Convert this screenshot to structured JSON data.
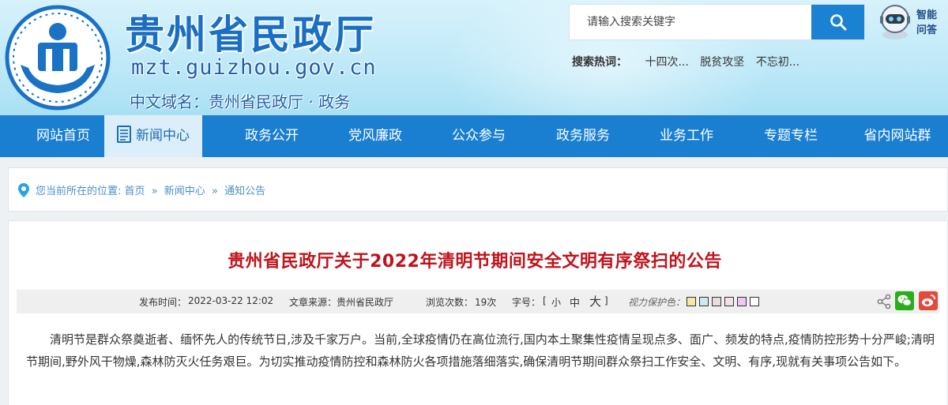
{
  "header": {
    "title": "贵州省民政厅",
    "domain": "mzt.guizhou.gov.cn",
    "cn_domain": "中文域名：贵州省民政厅 · 政务",
    "logo_icon": "civil-affairs-emblem",
    "search": {
      "placeholder": "请输入搜索关键字",
      "icon": "search-icon"
    },
    "hot_search": {
      "label": "搜索热词：",
      "keywords": [
        "十四次...",
        "脱贫攻坚",
        "不忘初..."
      ]
    },
    "assistant": {
      "label_line1": "智能",
      "label_line2": "问答"
    }
  },
  "nav": {
    "items": [
      {
        "label": "网站首页"
      },
      {
        "label": "新闻中心"
      },
      {
        "label": "政务公开"
      },
      {
        "label": "党风廉政"
      },
      {
        "label": "公众参与"
      },
      {
        "label": "政务服务"
      },
      {
        "label": "业务工作"
      },
      {
        "label": "专题专栏"
      },
      {
        "label": "省内网站群"
      }
    ],
    "active_index": 1
  },
  "breadcrumb": {
    "prefix": "您当前所在的位置:",
    "items": [
      "首页",
      "新闻中心",
      "通知公告"
    ],
    "separator": "»"
  },
  "article": {
    "title": "贵州省民政厅关于2022年清明节期间安全文明有序祭扫的公告",
    "meta": {
      "publish_label": "发布时间：",
      "publish_time": "2022-03-22 12:02",
      "source_label": "文章来源：",
      "source": "贵州省民政厅",
      "views_label": "浏览次数：",
      "views": "19次",
      "font_label": "字号：",
      "font_open": "[",
      "font_small": "小",
      "font_medium": "中",
      "font_large": "大",
      "font_close": "]",
      "vision_label": "视力保护色：",
      "vision_colors": [
        "#f8e6a8",
        "#cfe8ee",
        "#e6dede",
        "#f0e0e8",
        "#f0c8f0",
        "#ffffff"
      ]
    },
    "body": "清明节是群众祭奠逝者、缅怀先人的传统节日,涉及千家万户。当前,全球疫情仍在高位流行,国内本土聚集性疫情呈现点多、面广、频发的特点,疫情防控形势十分严峻;清明节期间,野外风干物燥,森林防灭火任务艰巨。为切实推动疫情防控和森林防火各项措施落细落实,确保清明节期间群众祭扫工作安全、文明、有序,现就有关事项公告如下。"
  },
  "colors": {
    "brand_blue": "#1a7fd1",
    "title_red": "#c0131b",
    "link_blue": "#4a90c9",
    "wechat_green": "#2bad1b",
    "weibo_red": "#e24b3c"
  }
}
